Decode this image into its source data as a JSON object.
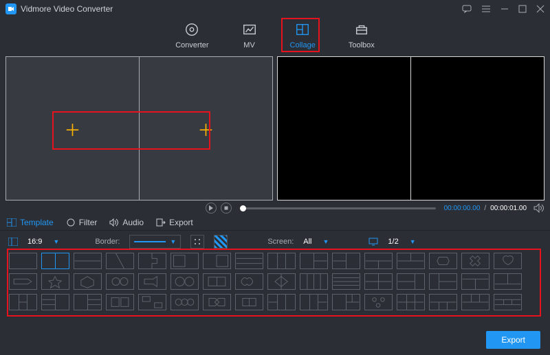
{
  "app": {
    "title": "Vidmore Video Converter"
  },
  "topnav": {
    "converter": "Converter",
    "mv": "MV",
    "collage": "Collage",
    "toolbox": "Toolbox"
  },
  "player": {
    "time_current": "00:00:00.00",
    "time_total": "00:00:01.00",
    "separator": "/"
  },
  "subtabs": {
    "template": "Template",
    "filter": "Filter",
    "audio": "Audio",
    "export": "Export"
  },
  "options": {
    "ratio_icon": "⿸",
    "ratio_value": "16:9",
    "border_label": "Border:",
    "screen_label": "Screen:",
    "screen_value": "All",
    "page_value": "1/2"
  },
  "footer": {
    "export": "Export"
  },
  "colors": {
    "accent": "#2196f3",
    "highlight": "#e10f19"
  }
}
